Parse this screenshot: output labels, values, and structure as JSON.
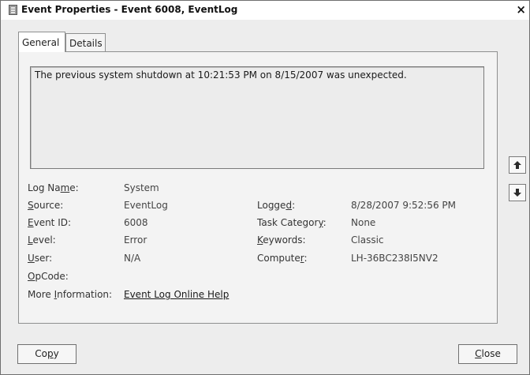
{
  "window": {
    "title": "Event Properties - Event 6008, EventLog",
    "close_glyph": "×"
  },
  "tabs": [
    {
      "label": "General",
      "active": true
    },
    {
      "label": "Details",
      "active": false
    }
  ],
  "description": "The previous system shutdown at 10:21:53 PM on 8/15/2007 was unexpected.",
  "properties": {
    "log_name": {
      "label_pre": "Log Na",
      "label_ul": "m",
      "label_post": "e:",
      "value": "System"
    },
    "source": {
      "label_pre": "",
      "label_ul": "S",
      "label_post": "ource:",
      "value": "EventLog"
    },
    "event_id": {
      "label_pre": "",
      "label_ul": "E",
      "label_post": "vent ID:",
      "value": "6008"
    },
    "level": {
      "label_pre": "",
      "label_ul": "L",
      "label_post": "evel:",
      "value": "Error"
    },
    "user": {
      "label_pre": "",
      "label_ul": "U",
      "label_post": "ser:",
      "value": "N/A"
    },
    "opcode": {
      "label_pre": "",
      "label_ul": "O",
      "label_post": "pCode:",
      "value": ""
    },
    "more_info": {
      "label_pre": "More ",
      "label_ul": "I",
      "label_post": "nformation:",
      "value": "Event Log Online Help"
    },
    "logged": {
      "label_pre": "Logge",
      "label_ul": "d",
      "label_post": ":",
      "value": "8/28/2007 9:52:56 PM"
    },
    "task_category": {
      "label_pre": "Task Categor",
      "label_ul": "y",
      "label_post": ":",
      "value": "None"
    },
    "keywords": {
      "label_pre": "",
      "label_ul": "K",
      "label_post": "eywords:",
      "value": "Classic"
    },
    "computer": {
      "label_pre": "Compute",
      "label_ul": "r",
      "label_post": ":",
      "value": "LH-36BC238I5NV2"
    }
  },
  "side_buttons": {
    "up": "arrow-up-icon",
    "down": "arrow-down-icon"
  },
  "buttons": {
    "copy": {
      "pre": "Co",
      "ul": "p",
      "post": "y"
    },
    "close": {
      "pre": "",
      "ul": "C",
      "post": "lose"
    }
  }
}
